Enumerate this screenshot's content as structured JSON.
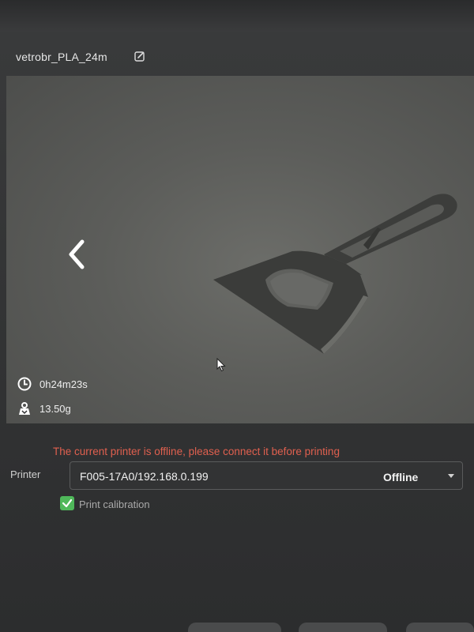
{
  "header": {
    "file_name": "vetrobr_PLA_24m",
    "edit_icon": "edit-icon"
  },
  "preview": {
    "back_icon": "chevron-left-icon",
    "model": "3d-model-preview",
    "stats": {
      "print_time": "0h24m23s",
      "time_icon": "clock-icon",
      "filament_weight": "13.50g",
      "weight_icon": "weight-icon"
    }
  },
  "warning": {
    "text": "The current printer is offline, please connect it before printing",
    "color": "#e0604f"
  },
  "printer": {
    "label": "Printer",
    "selected": "F005-17A0/192.168.0.199",
    "status": "Offline",
    "dropdown_icon": "chevron-down-icon"
  },
  "options": {
    "print_calibration": {
      "label": "Print calibration",
      "checked": true,
      "color": "#4fb85a"
    }
  }
}
